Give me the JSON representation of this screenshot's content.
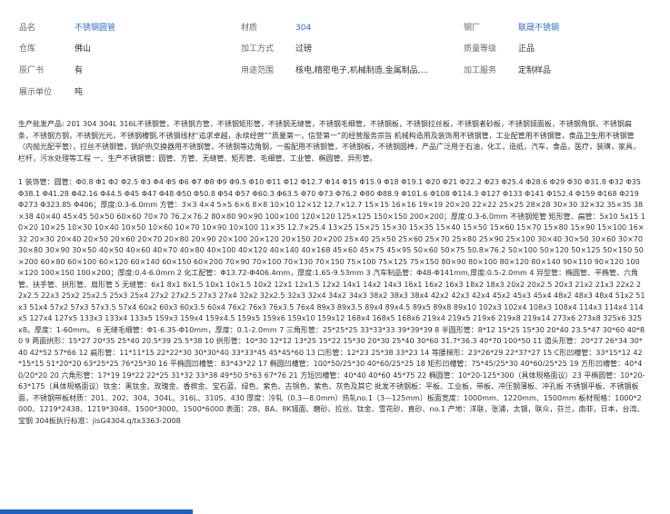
{
  "attributes": [
    {
      "label": "品名",
      "value": "不锈钢圆管",
      "link": true
    },
    {
      "label": "材质",
      "value": "304",
      "link": true
    },
    {
      "label": "钢厂",
      "value": "联晟不锈钢",
      "link": true
    },
    {
      "label": "仓库",
      "value": "佛山",
      "link": false
    },
    {
      "label": "加工方式",
      "value": "过磅",
      "link": false
    },
    {
      "label": "质量等级",
      "value": "正品",
      "link": false
    },
    {
      "label": "原厂书",
      "value": "有",
      "link": false
    },
    {
      "label": "用途范围",
      "value": "核电,精密电子,机械制造,金属制品,...",
      "link": false
    },
    {
      "label": "加工服务",
      "value": "定制样品",
      "link": false
    },
    {
      "label": "展示单位",
      "value": "吨",
      "link": false
    }
  ],
  "description": {
    "intro": "生产批发产品: 201 304 304L 316L不锈钢管，不锈钢方管，不锈钢矩形管，不锈钢无缝管，不锈钢毛细管，不锈钢板，不锈钢拉丝板，不锈钢者砂板，不锈钢镜面板，不锈钢角钢，不锈钢扁条，不锈钢方钢，不锈钢光元，不锈钢槽钢,不锈钢线材“追求卓越，永续经营”“质量第一，信誉第一”的经营服务宗旨 机械构造用及装饰用不锈钢管，工业配管用不锈钢管，食品卫生用不锈钢管（内抛光配平管），拉丝不锈钢管，锅炉热交换器用不锈钢管，不锈钢等边角钢，一般配用不锈钢管，不锈钢板，不锈钢圆棒，产品广泛用于石油，化工，造纸，汽车，食品，医疗，装璜，家具，栏杆，污水处理等工程 一、生产不锈钢管：圆管、方管、无缝管、矩形管、毛细管、工业管、椭圆管、异形管。",
    "specs": "1 装饰管：圆管：Φ0.8 Φ1 Φ2 Φ2.5 Φ3 Φ4 Φ5 Φ6 Φ7 Φ8 Φ9 Φ9.5 Φ10 Φ11 Φ12 Φ12.7 Φ14 Φ15 Φ15.9 Φ18 Φ19.1 Φ20 Φ21 Φ22.2 Φ23 Φ25.4 Φ28.6 Φ29 Φ30 Φ31.8 Φ32 Φ35 Φ38.1 Φ41.28 Φ42.16 Φ44.5 Φ45 Φ47 Φ48 Φ50 Φ50.8 Φ54 Φ57 Φ60.3 Φ63.5 Φ70 Φ73 Φ76.2 Φ80 Φ88.9 Φ101.6 Φ108 Φ114.3 Φ127 Φ133 Φ141 Φ152.4 Φ159 Φ168 Φ219 Φ273 Φ323.85 Φ406；厚度:0.3-6.0mm 方管：3×3 4×4 5×5 6×6 8×8 10×10 12×12 12.7×12.7 15×15 16×16 19×19 20×20 22×22 25×25 28×28 30×30 32×32 35×35 38×38 40×40 45×45 50×50 60×60 70×70 76.2×76.2 80×80 90×90 100×100 120×120 125×125 150×150 200×200；厚度:0.3-6.0mm 不锈钢矩管 矩形管、扁管：5x10 5x15 10×20 10×25 10×30 10×40 10×50 10×60 10×70 10×90 10×100 11×35 12.7×25.4 13×25 15×25 15×30 15×35 15×40 15×50 15×60 15×70 15×80 15×90 15×100 16×32 20×30 20×40 20×50 20×60 20×70 20×80 20×90 20×100 20×120 20×150 20×200 25×40 25×50 25×60 25×70 25×80 25×90 25×100 30×40 30×50 30×60 30×70 30×80 30×90 30×50 40×50 40×60 40×70 40×80 40×100 40×120 40×140 40×168 45×60 45×75 45×95 50×60 50×75 50.8×76.2 50×100 50×120 50×125 50×150 50×200 60×80 60×100 60×120 60×140 60×150 60×200 70×90 70×100 70×130 70×150 75×100 75×125 75×150 80×90 80×100 80×120 80×140 90×110 90×120 100×120 100×150 100×200；厚度:0.4-6.0mm 2 化工配管：Φ13.72-Φ406.4mm，厚度:1.65-9.53mm 3 汽车制品管：Φ48-Φ141mm,厚度:0.5-2.0mm 4 异型管：椭圆管、平椭管、六角管、扶手管、拱形管、扇形管 5 无缝管：6x1 8x1 8x1.5 10x1 10x1.5 10x2 12x1 12x1.5 12x2 14x1 14x2 14x3 16x1 16x2 16x3 18x2 18x3 20x2 20x2.5 20x3 21x2 21x3 22x2 22x2.5 22x3 25x2 25x2.5 25x3 25x4 27x2 27x2.5 27x3 27x4 32x2 32x2.5 32x3 32x4 34x2 34x3 38x2 38x3 38x4 42x2 42x3 42x4 45x2 45x3 45x4 48x2 48x3 48x4 51x2 51x3 51x4 57x2 57x3 57x3.5 57x4 60x2 60x3 60x3.5 60x4 76x2 76x3 76x3.5 76x4 89x3 89x3.5 89x4 89x4.5 89x5 89x8 89x10 102x3 102x4 108x3 108x4 114x3 114x4 114x5 127x4 127x5 133x3 133x4 133x5 159x3 159x4 159x4.5 159x5 159x6 159x10 159x12 168x4 168x5 168x6 219x4 219x5 219x6 219x8 219x14 273x6 273x8 325x6 325x8。厚度：1-60mm。 6 无缝毛细管：Φ1-6.35-Φ10mm，厚度：0.1-2.0mm 7 三角形管：25*25*25 33*33*33 39*39*39 8 半圆形管：8*12 15*25 15*30 20*40 23.5*47 30*60 40*80 9 两面拱形：15*27 20*35 25*40 20.5*39 25.5*38 10 拱形管：10*30 12*12 13*25 15*22 15*30 20*30 25*40 30*60 31.7*36.3 40*70 100*50 11 道头形管：20*27 26*34 30*40 42*52 57*66 12 扁形管：11*11*15 22*22*30 30*30*40 33*33*45 45*45*60 13 口形管：12*23 25*38 33*23 14 等腰梯形：23*26*29 22*37*27 15 C形凹槽管：33*15*12 42*15*15 51*20*20 63*25*25 76*25*30 16 平椭圆凹槽管：83*43*22 17 椭圆凹槽管：100*50/25*30 40*60/25*25 18 矩形凹槽管：75*45/25*30 40*60/25*25 19 方形凹槽管：40*40/20*20 20 六角形管：17*19 19*22 22*25 31*32 33*38 49*50 5*63 67*76 21 方短凹槽管：40*40 40*60 45*75 22 椭圆管：10*20-125*300（具体规格面议）23 平椭圆管：10*20-63*175（具体规格面议）钛金：黑钛金、玫瑰金、香槟金、宝石蓝、绿色、紫色、古铜色、紫色、灰色及其它 批发不锈钢板：平板、工业板、带板、冲压钢薄板、冲孔板 不锈钢平板、不锈钢板面，不锈钢带板材质：201、202、304、304L、316L、310S、430 厚度：冷轧（0.3—8.0mm）热轧no.1（3—125mm）板面宽度：1000mm、1220mm、1500mm 板材规格：1000*2000、1219*2438、1219*3048、1500*3000、1500*6000 表面：2B、BA、8K镜面、磨砂、拉丝、钛金、雪花砂、直砂、no.1 产地：洋联，张浦，太钢，联众，芬兰，南非，日本，台湾、宝钢 304板执行标准：jisG4304.q/tx3363-2008"
  },
  "colors": {
    "link": "#2d6cc8",
    "label": "#666666",
    "text": "#333333",
    "accent_bar": "#1f5fbf"
  }
}
